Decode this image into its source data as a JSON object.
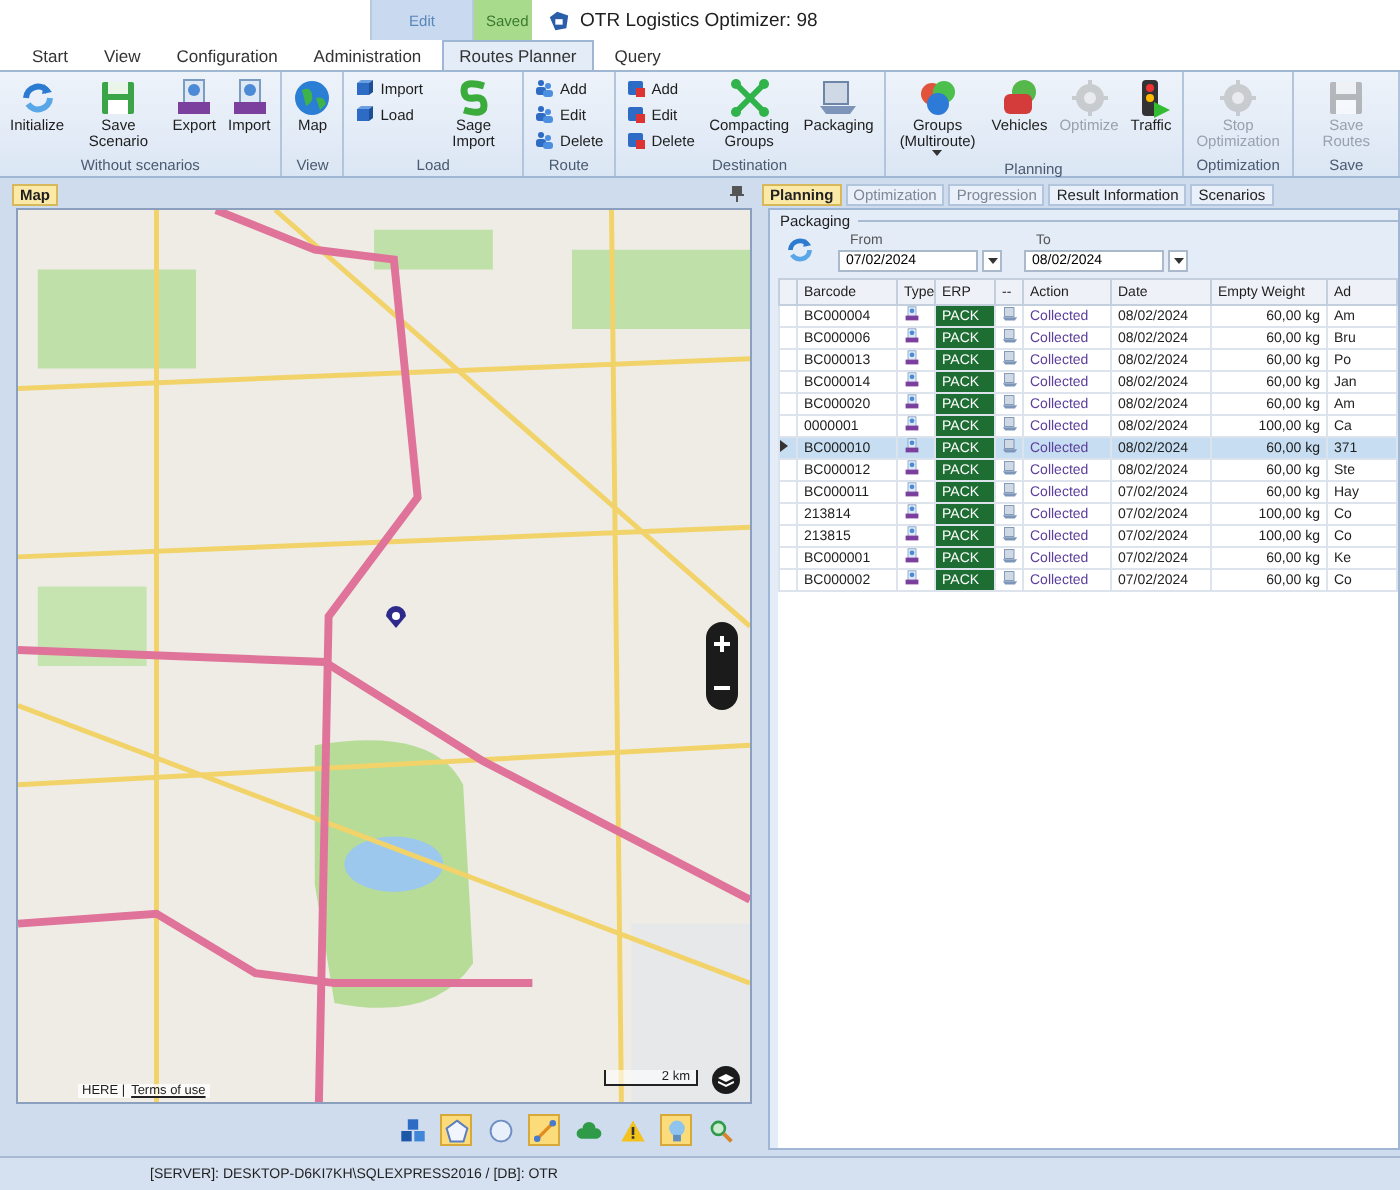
{
  "window": {
    "title": "OTR Logistics Optimizer: 98"
  },
  "contextual_tabs": [
    {
      "label": "Edit",
      "color": "#c9daf0"
    },
    {
      "label": "Saved",
      "color": "#a8dc8c"
    }
  ],
  "tabs": [
    {
      "label": "Start",
      "selected": false
    },
    {
      "label": "View",
      "selected": false
    },
    {
      "label": "Configuration",
      "selected": false
    },
    {
      "label": "Administration",
      "selected": false
    },
    {
      "label": "Routes Planner",
      "selected": true
    },
    {
      "label": "Query",
      "selected": false
    }
  ],
  "ribbon": [
    {
      "label": "Without scenarios",
      "buttons": [
        {
          "label": "Initialize",
          "kind": "large",
          "disabled": false
        },
        {
          "label": "Save Scenario",
          "kind": "large",
          "disabled": false
        },
        {
          "label": "Export",
          "kind": "large",
          "disabled": false
        },
        {
          "label": "Import",
          "kind": "large",
          "disabled": false
        }
      ]
    },
    {
      "label": "View",
      "buttons": [
        {
          "label": "Map",
          "kind": "large",
          "disabled": false
        }
      ]
    },
    {
      "label": "Load",
      "buttons": [
        {
          "label": "Import",
          "kind": "small",
          "disabled": false
        },
        {
          "label": "Load",
          "kind": "small",
          "disabled": false
        },
        {
          "label": "Sage Import",
          "kind": "large",
          "disabled": false
        }
      ]
    },
    {
      "label": "Route",
      "buttons": [
        {
          "label": "Add",
          "kind": "small",
          "disabled": false
        },
        {
          "label": "Edit",
          "kind": "small",
          "disabled": false
        },
        {
          "label": "Delete",
          "kind": "small",
          "disabled": false
        }
      ]
    },
    {
      "label": "Destination",
      "buttons": [
        {
          "label": "Add",
          "kind": "small",
          "disabled": false
        },
        {
          "label": "Edit",
          "kind": "small",
          "disabled": false
        },
        {
          "label": "Delete",
          "kind": "small",
          "disabled": false
        },
        {
          "label": "Compacting Groups",
          "kind": "large",
          "disabled": false
        },
        {
          "label": "Packaging",
          "kind": "large",
          "disabled": false
        }
      ]
    },
    {
      "label": "Planning",
      "buttons": [
        {
          "label": "Groups (Multiroute)",
          "kind": "split",
          "disabled": false
        },
        {
          "label": "Vehicles",
          "kind": "large",
          "disabled": false
        },
        {
          "label": "Optimize",
          "kind": "large",
          "disabled": true
        },
        {
          "label": "Traffic",
          "kind": "large",
          "disabled": false
        }
      ]
    },
    {
      "label": "Optimization",
      "buttons": [
        {
          "label": "Stop Optimization",
          "kind": "large",
          "disabled": true
        }
      ]
    },
    {
      "label": "Save",
      "buttons": [
        {
          "label": "Save Routes",
          "kind": "large",
          "disabled": true
        }
      ]
    }
  ],
  "map_panel": {
    "title": "Map",
    "scale": "2 km",
    "attribution": {
      "provider": "HERE |",
      "link": "Terms of use"
    },
    "tools": [
      {
        "kind": "cubes",
        "selected": false
      },
      {
        "kind": "pentagon",
        "selected": true
      },
      {
        "kind": "circle",
        "selected": false
      },
      {
        "kind": "route",
        "selected": true
      },
      {
        "kind": "cloud",
        "selected": false
      },
      {
        "kind": "warning",
        "selected": false
      },
      {
        "kind": "bulb",
        "selected": true
      },
      {
        "kind": "magnifier",
        "selected": false
      }
    ]
  },
  "right_tabs": [
    {
      "label": "Planning",
      "selected": true,
      "disabled": false
    },
    {
      "label": "Optimization",
      "selected": false,
      "disabled": true
    },
    {
      "label": "Progression",
      "selected": false,
      "disabled": true
    },
    {
      "label": "Result Information",
      "selected": false,
      "disabled": false
    },
    {
      "label": "Scenarios",
      "selected": false,
      "disabled": false
    }
  ],
  "packaging": {
    "title": "Packaging",
    "from": {
      "label": "From",
      "value": "07/02/2024"
    },
    "to": {
      "label": "To",
      "value": "08/02/2024"
    },
    "columns": [
      "Barcode",
      "Type",
      "ERP",
      "--",
      "Action",
      "Date",
      "Empty Weight",
      "Ad"
    ],
    "rows": [
      {
        "barcode": "BC000004",
        "erp": "PACK",
        "action": "Collected",
        "date": "08/02/2024",
        "weight": "60,00 kg",
        "column_8": "Am",
        "selected": false
      },
      {
        "barcode": "BC000006",
        "erp": "PACK",
        "action": "Collected",
        "date": "08/02/2024",
        "weight": "60,00 kg",
        "column_8": "Bru",
        "selected": false
      },
      {
        "barcode": "BC000013",
        "erp": "PACK",
        "action": "Collected",
        "date": "08/02/2024",
        "weight": "60,00 kg",
        "column_8": "Po",
        "selected": false
      },
      {
        "barcode": "BC000014",
        "erp": "PACK",
        "action": "Collected",
        "date": "08/02/2024",
        "weight": "60,00 kg",
        "column_8": "Jan",
        "selected": false
      },
      {
        "barcode": "BC000020",
        "erp": "PACK",
        "action": "Collected",
        "date": "08/02/2024",
        "weight": "60,00 kg",
        "column_8": "Am",
        "selected": false
      },
      {
        "barcode": "0000001",
        "erp": "PACK",
        "action": "Collected",
        "date": "08/02/2024",
        "weight": "100,00 kg",
        "column_8": "Ca",
        "selected": false
      },
      {
        "barcode": "BC000010",
        "erp": "PACK",
        "action": "Collected",
        "date": "08/02/2024",
        "weight": "60,00 kg",
        "column_8": "371",
        "selected": true
      },
      {
        "barcode": "BC000012",
        "erp": "PACK",
        "action": "Collected",
        "date": "08/02/2024",
        "weight": "60,00 kg",
        "column_8": "Ste",
        "selected": false
      },
      {
        "barcode": "BC000011",
        "erp": "PACK",
        "action": "Collected",
        "date": "07/02/2024",
        "weight": "60,00 kg",
        "column_8": "Hay",
        "selected": false
      },
      {
        "barcode": "213814",
        "erp": "PACK",
        "action": "Collected",
        "date": "07/02/2024",
        "weight": "100,00 kg",
        "column_8": "Co",
        "selected": false
      },
      {
        "barcode": "213815",
        "erp": "PACK",
        "action": "Collected",
        "date": "07/02/2024",
        "weight": "100,00 kg",
        "column_8": "Co",
        "selected": false
      },
      {
        "barcode": "BC000001",
        "erp": "PACK",
        "action": "Collected",
        "date": "07/02/2024",
        "weight": "60,00 kg",
        "column_8": "Ke",
        "selected": false
      },
      {
        "barcode": "BC000002",
        "erp": "PACK",
        "action": "Collected",
        "date": "07/02/2024",
        "weight": "60,00 kg",
        "column_8": "Co",
        "selected": false
      }
    ]
  },
  "status_bar": {
    "text": "[SERVER]: DESKTOP-D6KI7KH\\SQLEXPRESS2016 / [DB]: OTR"
  }
}
